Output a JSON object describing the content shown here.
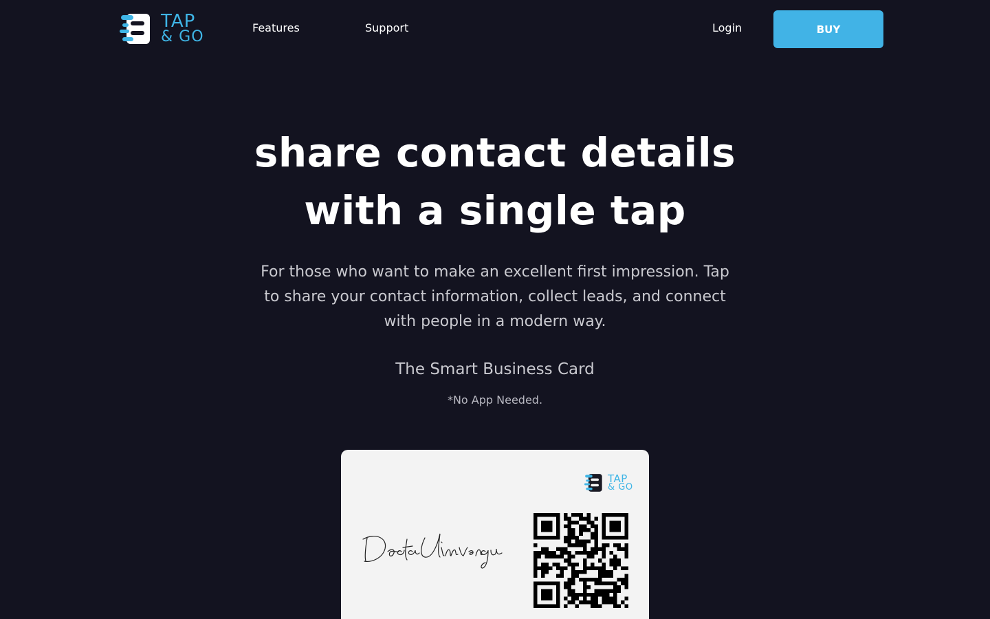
{
  "header": {
    "logo": {
      "line1": "TAP",
      "line2": "& GO"
    },
    "nav": {
      "features": "Features",
      "support": "Support",
      "login": "Login"
    },
    "buy_label": "BUY"
  },
  "hero": {
    "title_line1": "share contact details",
    "title_line2": "with a single tap",
    "subtitle": "For those who want to make an excellent first impression. Tap to share your contact information, collect leads, and connect with people in a modern way.",
    "tagline": "The Smart Business Card",
    "note": "*No App Needed."
  },
  "card": {
    "logo": {
      "line1": "TAP",
      "line2": "& GO"
    },
    "signature": "Docta Umwengu"
  },
  "colors": {
    "background": "#131320",
    "accent": "#41b3e6",
    "text": "#ffffff",
    "muted": "#c9c9cf"
  }
}
